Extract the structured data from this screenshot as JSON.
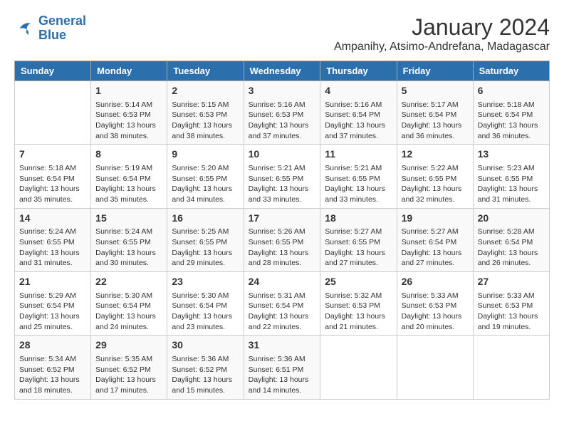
{
  "logo": {
    "line1": "General",
    "line2": "Blue"
  },
  "title": "January 2024",
  "subtitle": "Ampanihy, Atsimo-Andrefana, Madagascar",
  "days_header": [
    "Sunday",
    "Monday",
    "Tuesday",
    "Wednesday",
    "Thursday",
    "Friday",
    "Saturday"
  ],
  "weeks": [
    [
      {
        "day": "",
        "sunrise": "",
        "sunset": "",
        "daylight": ""
      },
      {
        "day": "1",
        "sunrise": "5:14 AM",
        "sunset": "6:53 PM",
        "daylight": "13 hours and 38 minutes."
      },
      {
        "day": "2",
        "sunrise": "5:15 AM",
        "sunset": "6:53 PM",
        "daylight": "13 hours and 38 minutes."
      },
      {
        "day": "3",
        "sunrise": "5:16 AM",
        "sunset": "6:53 PM",
        "daylight": "13 hours and 37 minutes."
      },
      {
        "day": "4",
        "sunrise": "5:16 AM",
        "sunset": "6:54 PM",
        "daylight": "13 hours and 37 minutes."
      },
      {
        "day": "5",
        "sunrise": "5:17 AM",
        "sunset": "6:54 PM",
        "daylight": "13 hours and 36 minutes."
      },
      {
        "day": "6",
        "sunrise": "5:18 AM",
        "sunset": "6:54 PM",
        "daylight": "13 hours and 36 minutes."
      }
    ],
    [
      {
        "day": "7",
        "sunrise": "5:18 AM",
        "sunset": "6:54 PM",
        "daylight": "13 hours and 35 minutes."
      },
      {
        "day": "8",
        "sunrise": "5:19 AM",
        "sunset": "6:54 PM",
        "daylight": "13 hours and 35 minutes."
      },
      {
        "day": "9",
        "sunrise": "5:20 AM",
        "sunset": "6:55 PM",
        "daylight": "13 hours and 34 minutes."
      },
      {
        "day": "10",
        "sunrise": "5:21 AM",
        "sunset": "6:55 PM",
        "daylight": "13 hours and 33 minutes."
      },
      {
        "day": "11",
        "sunrise": "5:21 AM",
        "sunset": "6:55 PM",
        "daylight": "13 hours and 33 minutes."
      },
      {
        "day": "12",
        "sunrise": "5:22 AM",
        "sunset": "6:55 PM",
        "daylight": "13 hours and 32 minutes."
      },
      {
        "day": "13",
        "sunrise": "5:23 AM",
        "sunset": "6:55 PM",
        "daylight": "13 hours and 31 minutes."
      }
    ],
    [
      {
        "day": "14",
        "sunrise": "5:24 AM",
        "sunset": "6:55 PM",
        "daylight": "13 hours and 31 minutes."
      },
      {
        "day": "15",
        "sunrise": "5:24 AM",
        "sunset": "6:55 PM",
        "daylight": "13 hours and 30 minutes."
      },
      {
        "day": "16",
        "sunrise": "5:25 AM",
        "sunset": "6:55 PM",
        "daylight": "13 hours and 29 minutes."
      },
      {
        "day": "17",
        "sunrise": "5:26 AM",
        "sunset": "6:55 PM",
        "daylight": "13 hours and 28 minutes."
      },
      {
        "day": "18",
        "sunrise": "5:27 AM",
        "sunset": "6:55 PM",
        "daylight": "13 hours and 27 minutes."
      },
      {
        "day": "19",
        "sunrise": "5:27 AM",
        "sunset": "6:54 PM",
        "daylight": "13 hours and 27 minutes."
      },
      {
        "day": "20",
        "sunrise": "5:28 AM",
        "sunset": "6:54 PM",
        "daylight": "13 hours and 26 minutes."
      }
    ],
    [
      {
        "day": "21",
        "sunrise": "5:29 AM",
        "sunset": "6:54 PM",
        "daylight": "13 hours and 25 minutes."
      },
      {
        "day": "22",
        "sunrise": "5:30 AM",
        "sunset": "6:54 PM",
        "daylight": "13 hours and 24 minutes."
      },
      {
        "day": "23",
        "sunrise": "5:30 AM",
        "sunset": "6:54 PM",
        "daylight": "13 hours and 23 minutes."
      },
      {
        "day": "24",
        "sunrise": "5:31 AM",
        "sunset": "6:54 PM",
        "daylight": "13 hours and 22 minutes."
      },
      {
        "day": "25",
        "sunrise": "5:32 AM",
        "sunset": "6:53 PM",
        "daylight": "13 hours and 21 minutes."
      },
      {
        "day": "26",
        "sunrise": "5:33 AM",
        "sunset": "6:53 PM",
        "daylight": "13 hours and 20 minutes."
      },
      {
        "day": "27",
        "sunrise": "5:33 AM",
        "sunset": "6:53 PM",
        "daylight": "13 hours and 19 minutes."
      }
    ],
    [
      {
        "day": "28",
        "sunrise": "5:34 AM",
        "sunset": "6:52 PM",
        "daylight": "13 hours and 18 minutes."
      },
      {
        "day": "29",
        "sunrise": "5:35 AM",
        "sunset": "6:52 PM",
        "daylight": "13 hours and 17 minutes."
      },
      {
        "day": "30",
        "sunrise": "5:36 AM",
        "sunset": "6:52 PM",
        "daylight": "13 hours and 15 minutes."
      },
      {
        "day": "31",
        "sunrise": "5:36 AM",
        "sunset": "6:51 PM",
        "daylight": "13 hours and 14 minutes."
      },
      {
        "day": "",
        "sunrise": "",
        "sunset": "",
        "daylight": ""
      },
      {
        "day": "",
        "sunrise": "",
        "sunset": "",
        "daylight": ""
      },
      {
        "day": "",
        "sunrise": "",
        "sunset": "",
        "daylight": ""
      }
    ]
  ]
}
